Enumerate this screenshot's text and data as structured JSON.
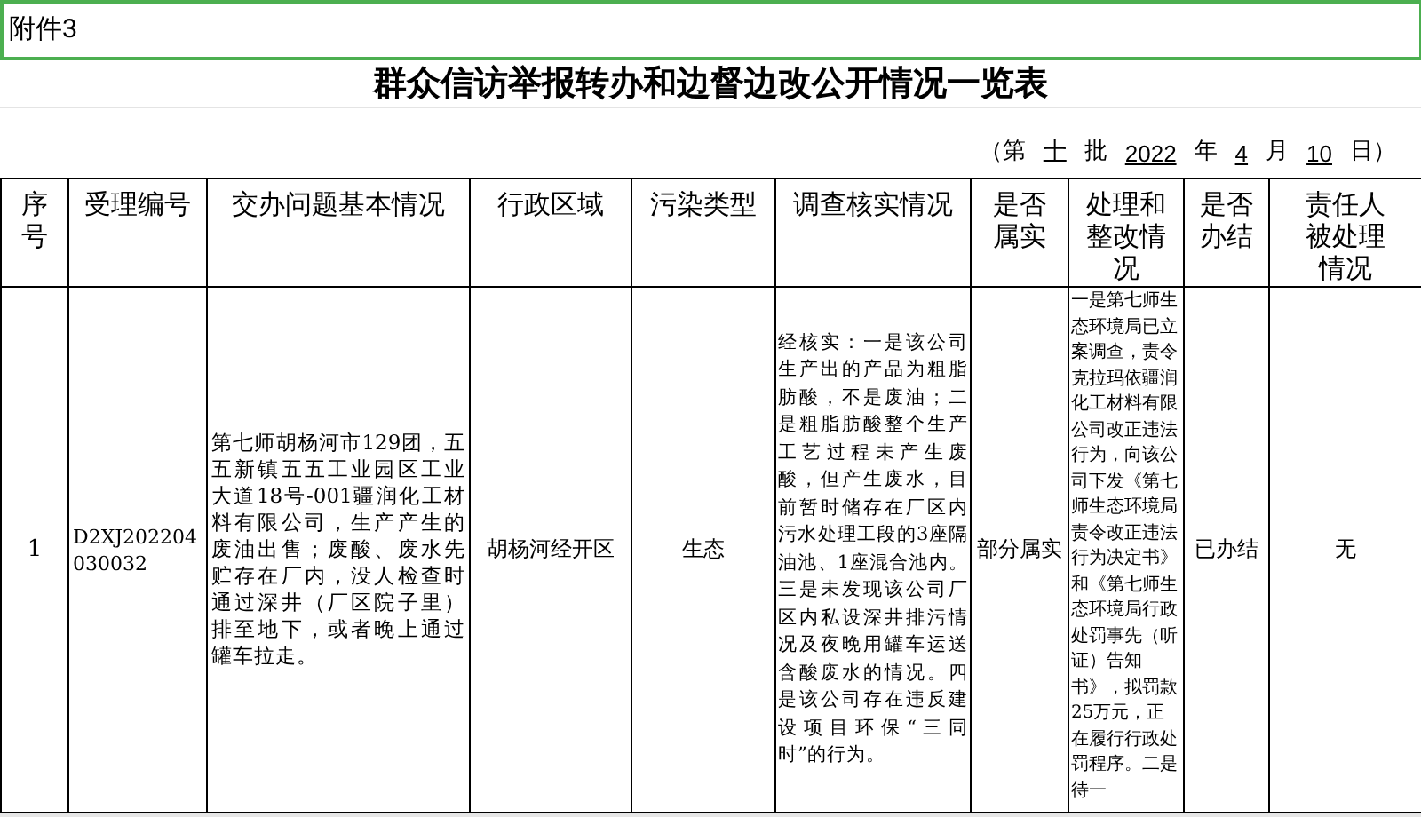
{
  "attachment_label": "附件3",
  "title": "群众信访举报转办和边督边改公开情况一览表",
  "batch_line": [
    {
      "text": "（第",
      "underlined": false
    },
    {
      "text": "十",
      "underlined": true
    },
    {
      "text": "批",
      "underlined": false
    },
    {
      "text": "2022",
      "underlined": true
    },
    {
      "text": "年",
      "underlined": false
    },
    {
      "text": "4",
      "underlined": true
    },
    {
      "text": "月",
      "underlined": false
    },
    {
      "text": "10",
      "underlined": true
    },
    {
      "text": "日）",
      "underlined": false
    }
  ],
  "table": {
    "columns": [
      "序号",
      "受理编号",
      "交办问题基本情况",
      "行政区域",
      "污染类型",
      "调查核实情况",
      "是否属实",
      "处理和整改情况",
      "是否办结",
      "责任人被处理情况"
    ],
    "rows": [
      [
        "1",
        "D2XJ202204030032",
        "第七师胡杨河市129团，五五新镇五五工业园区工业大道18号-001疆润化工材料有限公司，生产产生的废油出售；废酸、废水先贮存在厂内，没人检查时通过深井（厂区院子里）排至地下，或者晚上通过罐车拉走。",
        "胡杨河经开区",
        "生态",
        "经核实：一是该公司生产出的产品为粗脂肪酸，不是废油；二是粗脂肪酸整个生产工艺过程未产生废酸，但产生废水，目前暂时储存在厂区内污水处理工段的3座隔油池、1座混合池内。三是未发现该公司厂区内私设深井排污情况及夜晚用罐车运送含酸废水的情况。四是该公司存在违反建设项目环保“三同时”的行为。",
        "部分属实",
        "一是第七师生态环境局已立案调查，责令克拉玛依疆润化工材料有限公司改正违法行为，向该公司下发《第七师生态环境局责令改正违法行为决定书》和《第七师生态环境局行政处罚事先（听证）告知书》，拟罚款25万元，正在履行行政处罚程序。二是待一",
        "已办结",
        "无"
      ]
    ]
  }
}
